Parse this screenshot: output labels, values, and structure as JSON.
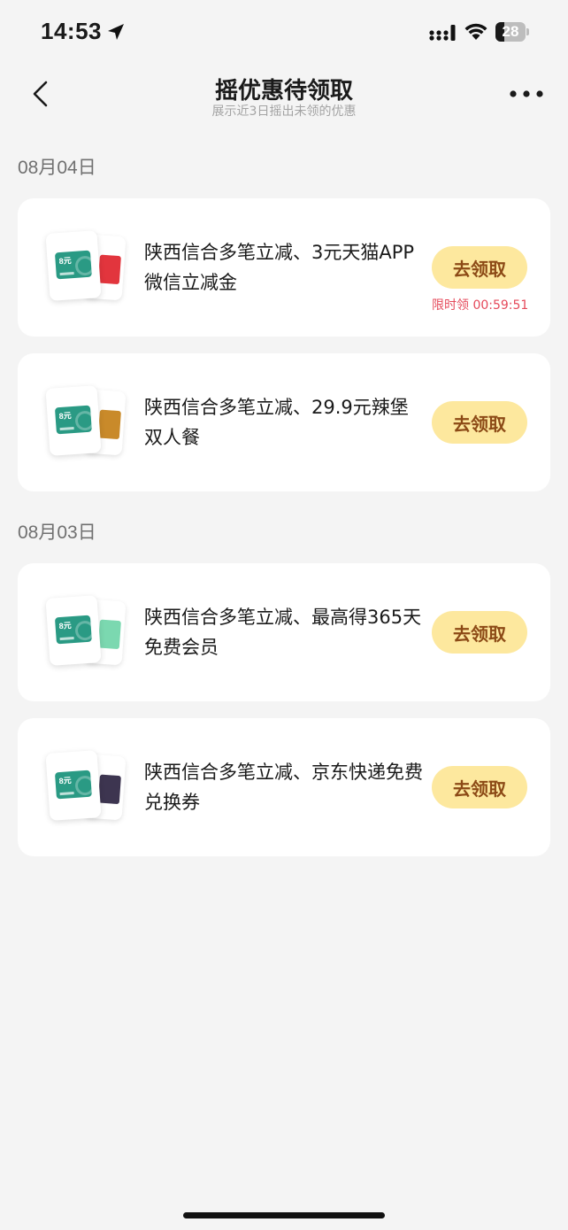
{
  "status_bar": {
    "time": "14:53",
    "battery": "28",
    "battery_level": 0.28
  },
  "nav": {
    "title": "摇优惠待领取",
    "subtitle": "展示近3日摇出未领的优惠"
  },
  "groups": [
    {
      "date": "08月04日",
      "items": [
        {
          "title": "陕西信合多笔立减、3元天猫APP微信立减金",
          "button": "去领取",
          "timer": "限时领 00:59:51",
          "card_number": "8元",
          "side_color": "#e2353d"
        },
        {
          "title": "陕西信合多笔立减、29.9元辣堡双人餐",
          "button": "去领取",
          "card_number": "8元",
          "side_color": "#c98a2a"
        }
      ]
    },
    {
      "date": "08月03日",
      "items": [
        {
          "title": "陕西信合多笔立减、最高得365天免费会员",
          "button": "去领取",
          "card_number": "8元",
          "side_color": "#7bd8b0"
        },
        {
          "title": "陕西信合多笔立减、京东快递免费兑换券",
          "button": "去领取",
          "card_number": "8元",
          "side_color": "#3d3550"
        }
      ]
    }
  ],
  "colors": {
    "background": "#f4f4f4",
    "button_bg": "#fde89e",
    "button_text": "#8c4a16",
    "timer": "#e5495a",
    "mini_card": "#2a9a84"
  },
  "icons": {
    "back": "chevron-left-icon",
    "more": "more-dots-icon",
    "location": "location-arrow-icon",
    "signal": "cellular-signal-icon",
    "wifi": "wifi-icon"
  }
}
